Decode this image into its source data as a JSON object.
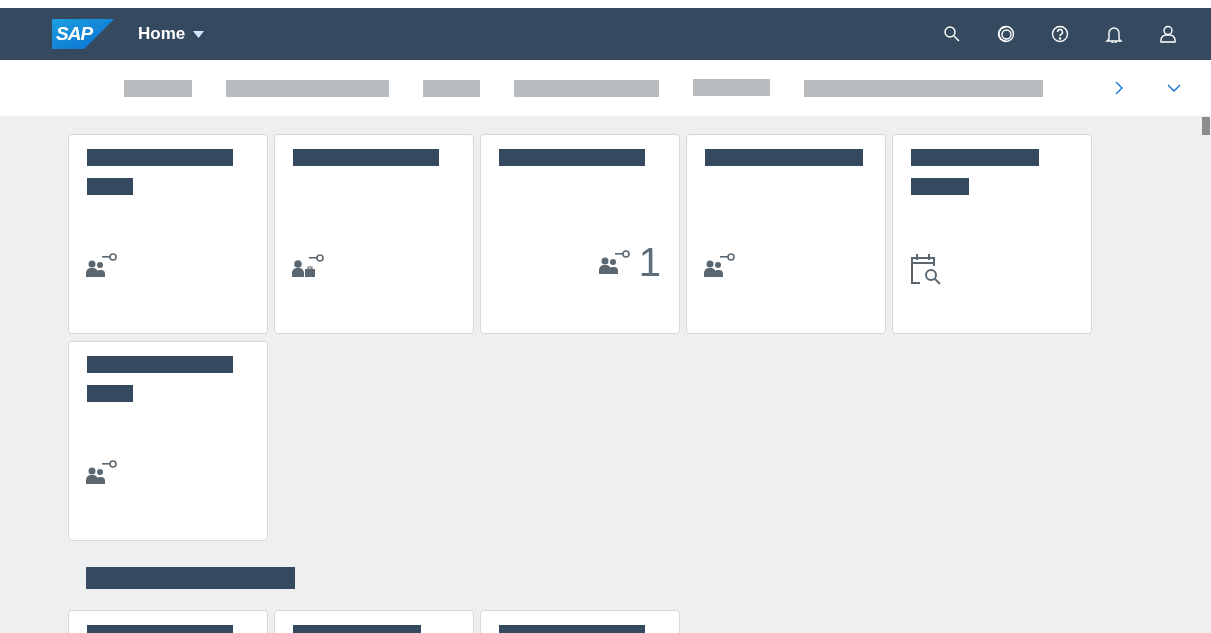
{
  "shell": {
    "logo": "SAP",
    "title": "Home",
    "actions": [
      {
        "kind": "search"
      },
      {
        "kind": "copilot"
      },
      {
        "kind": "help"
      },
      {
        "kind": "notifications"
      },
      {
        "kind": "user"
      }
    ]
  },
  "anchor_bar": {
    "items": [
      {
        "kind": "redacted"
      },
      {
        "kind": "redacted"
      },
      {
        "kind": "redacted"
      },
      {
        "kind": "redacted"
      },
      {
        "kind": "redacted"
      },
      {
        "kind": "redacted"
      }
    ]
  },
  "groups": [
    {
      "tiles": [
        {
          "kind": "people-key"
        },
        {
          "kind": "person-briefcase"
        },
        {
          "kind": "people-key",
          "number": "1"
        },
        {
          "kind": "people-key"
        },
        {
          "kind": "calendar-search"
        },
        {
          "kind": "people-key"
        }
      ]
    },
    {
      "title": {
        "kind": "redacted"
      },
      "tiles": [
        {
          "kind": "plain"
        },
        {
          "kind": "plain"
        },
        {
          "kind": "plain"
        }
      ]
    }
  ]
}
